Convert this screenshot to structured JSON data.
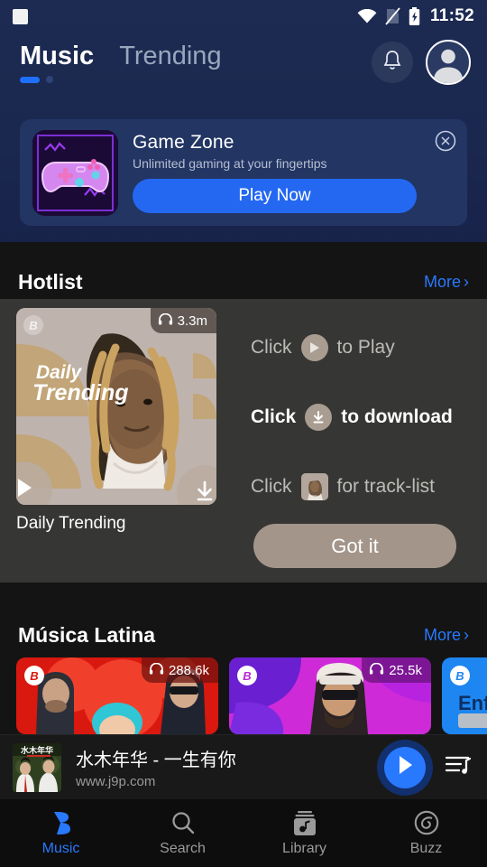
{
  "statusbar": {
    "time": "11:52",
    "icons": [
      "screenshot-square-icon",
      "wifi-icon",
      "sim-card-off-icon",
      "battery-charging-icon"
    ]
  },
  "header": {
    "tabs": [
      {
        "label": "Music",
        "active": true
      },
      {
        "label": "Trending",
        "active": false
      }
    ],
    "notification_icon": "bell-icon",
    "avatar_icon": "user-avatar-icon",
    "accent_color": "#1f6fff",
    "background_color": "#1d2b52"
  },
  "banner": {
    "title": "Game Zone",
    "subtitle": "Unlimited gaming at your fingertips",
    "cta_label": "Play Now",
    "cta_color": "#2468f2",
    "close_icon": "close-circle-icon",
    "thumb_icon": "gamepad-icon"
  },
  "hotlist": {
    "title": "Hotlist",
    "more_label": "More",
    "more_chevron": "chevron-right-icon",
    "card": {
      "name": "Daily Trending",
      "plays": "3.3m",
      "plays_icon": "headphones-icon",
      "badge": "B",
      "play_icon": "play-icon",
      "download_icon": "download-icon",
      "cover_text_line1": "Daily",
      "cover_text_line2": "Trending"
    }
  },
  "tutorial": {
    "row1_prefix": "Click",
    "row1_icon": "play-icon",
    "row1_suffix": "to Play",
    "row2_prefix": "Click",
    "row2_icon": "download-icon",
    "row2_suffix": "to download",
    "row3_prefix": "Click",
    "row3_icon": "album-thumbnail-icon",
    "row3_suffix": "for track-list",
    "dismiss_label": "Got it",
    "dismiss_color": "#a3958a",
    "spotlight_color": "#363634"
  },
  "latina": {
    "title": "Música Latina",
    "more_label": "More",
    "cards": [
      {
        "plays": "288.6k",
        "plays_icon": "headphones-icon",
        "badge": "B",
        "color": "#e21b1b"
      },
      {
        "plays": "25.5k",
        "plays_icon": "headphones-icon",
        "badge": "B",
        "color": "#b829d6"
      },
      {
        "badge": "B",
        "color": "#1e86f0",
        "text": "Enfo"
      }
    ]
  },
  "player": {
    "title": "水木年华 - 一生有你",
    "subtitle": "www.j9p.com",
    "play_icon": "play-icon",
    "queue_icon": "playlist-queue-icon",
    "play_color": "#2979ff"
  },
  "bottomnav": {
    "items": [
      {
        "label": "Music",
        "icon": "b-logo-icon",
        "active": true
      },
      {
        "label": "Search",
        "icon": "search-icon",
        "active": false
      },
      {
        "label": "Library",
        "icon": "library-icon",
        "active": false
      },
      {
        "label": "Buzz",
        "icon": "buzz-disc-icon",
        "active": false
      }
    ],
    "active_color": "#2979ff"
  }
}
